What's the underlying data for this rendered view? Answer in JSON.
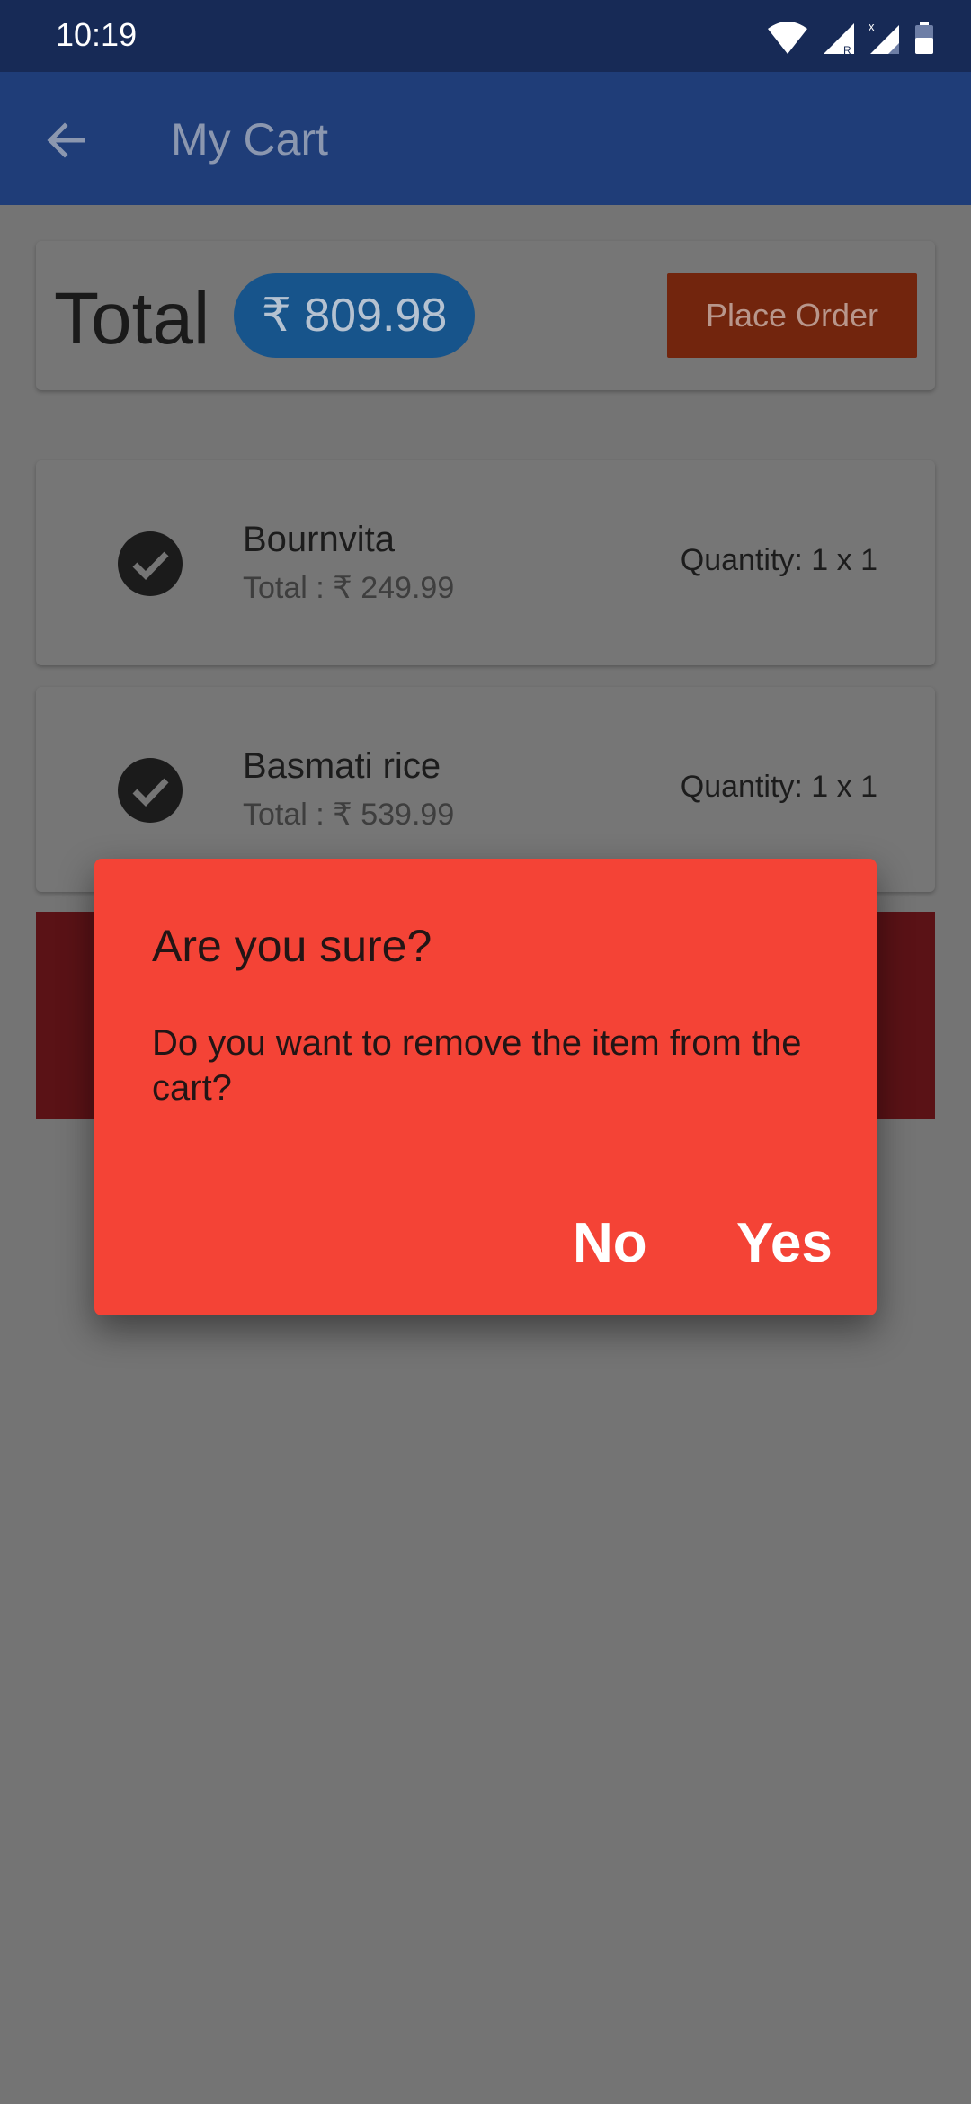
{
  "status_bar": {
    "time": "10:19"
  },
  "app_bar": {
    "title": "My Cart"
  },
  "summary": {
    "total_label": "Total",
    "total_amount": "₹ 809.98",
    "place_order_label": "Place Order"
  },
  "items": [
    {
      "name": "Bournvita",
      "total": "Total : ₹ 249.99",
      "quantity": "Quantity: 1 x 1"
    },
    {
      "name": "Basmati rice",
      "total": "Total : ₹ 539.99",
      "quantity": "Quantity: 1 x 1"
    }
  ],
  "dialog": {
    "title": "Are you sure?",
    "message": "Do you want to remove the item from the cart?",
    "no_label": "No",
    "yes_label": "Yes"
  },
  "colors": {
    "status_bar": "#172a56",
    "app_bar": "#1f3d78",
    "dialog": "#f44336",
    "total_pill": "#17548b",
    "place_order": "#72250d"
  }
}
